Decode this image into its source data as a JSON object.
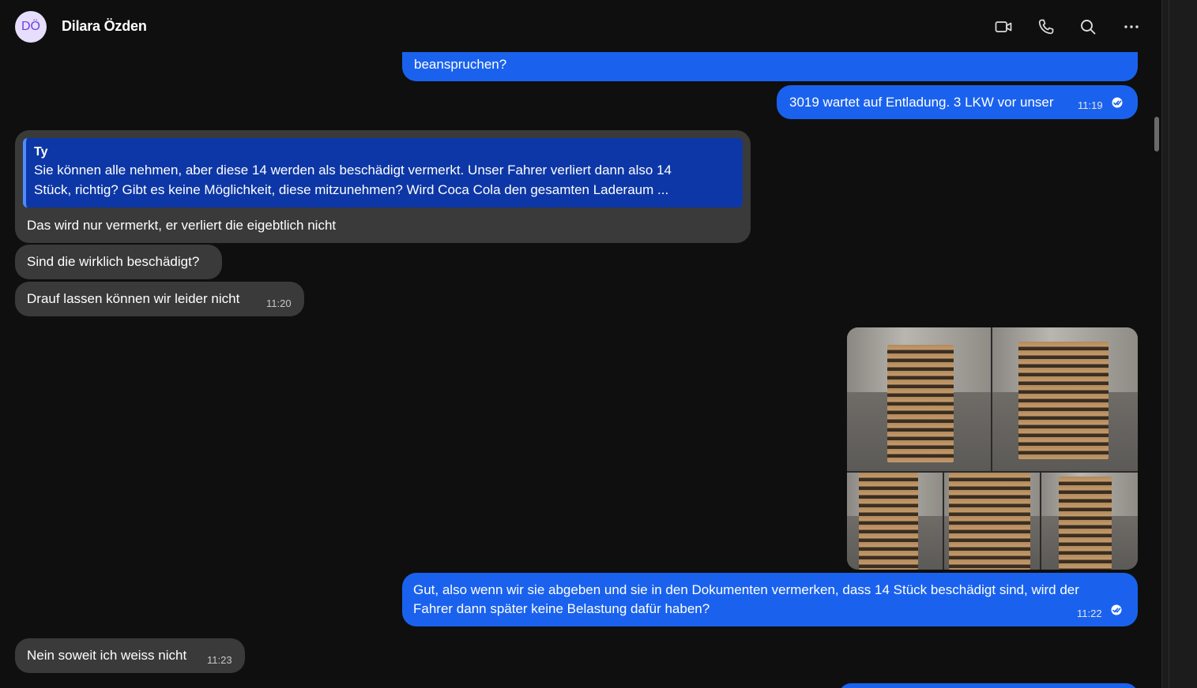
{
  "header": {
    "avatar_initials": "DÖ",
    "contact_name": "Dilara Özden",
    "icons": [
      "video-call-icon",
      "phone-call-icon",
      "search-icon",
      "more-options-icon"
    ]
  },
  "messages": {
    "m1": {
      "text": "beanspruchen?",
      "direction": "outgoing"
    },
    "m2": {
      "text": "3019 wartet auf Entladung. 3 LKW vor unser",
      "time": "11:19",
      "direction": "outgoing",
      "status": "read"
    },
    "m3": {
      "direction": "incoming",
      "quote_author": "Ty",
      "quote_text_line1": "Sie können alle nehmen, aber diese 14 werden als beschädigt vermerkt. Unser Fahrer verliert dann also 14",
      "quote_text_line2": "Stück, richtig? Gibt es keine Möglichkeit, diese mitzunehmen? Wird Coca Cola den gesamten Laderaum ...",
      "text": "Das wird nur vermerkt, er verliert die eigebtlich nicht"
    },
    "m4": {
      "text": "Sind die wirklich beschädigt?",
      "direction": "incoming"
    },
    "m5": {
      "text": "Drauf lassen können wir leider nicht",
      "time": "11:20",
      "direction": "incoming"
    },
    "m6": {
      "type": "media-album",
      "photo_count": 5,
      "direction": "outgoing"
    },
    "m7": {
      "line1": "Gut, also wenn wir sie abgeben und sie in den Dokumenten vermerken, dass 14 Stück beschädigt sind, wird der",
      "line2": "Fahrer dann später keine Belastung dafür haben?",
      "time": "11:22",
      "direction": "outgoing",
      "status": "read"
    },
    "m8": {
      "text": "Nein soweit ich weiss nicht",
      "time": "11:23",
      "direction": "incoming"
    }
  },
  "colors": {
    "outgoing_bubble": "#1a62ee",
    "incoming_bubble": "#3a3a3a",
    "quote_background": "#0d37a6",
    "background": "#0f0f0f",
    "avatar_background": "#e7defd",
    "avatar_text": "#6c3fe0"
  }
}
